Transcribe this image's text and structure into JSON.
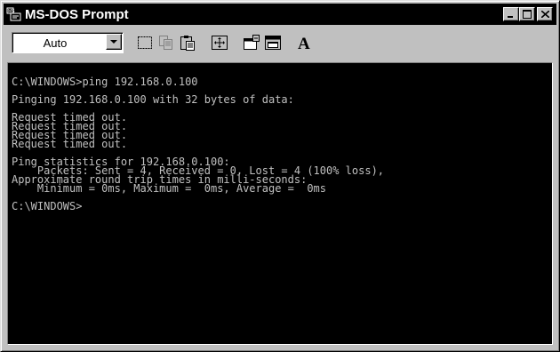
{
  "window": {
    "title": "MS-DOS Prompt",
    "icon": "msdos-icon",
    "controls": [
      "minimize-icon",
      "maximize-icon",
      "close-icon"
    ]
  },
  "toolbar": {
    "font_size_value": "Auto",
    "tools": [
      "mark-icon",
      "copy-icon",
      "paste-icon",
      "fullscreen-icon",
      "properties-icon",
      "background-icon",
      "font-icon"
    ],
    "font_button_glyph": "A"
  },
  "console": {
    "text_color": "#c0c0c0",
    "background_color": "#000000",
    "lines": [
      "C:\\WINDOWS>ping 192.168.0.100",
      "",
      "Pinging 192.168.0.100 with 32 bytes of data:",
      "",
      "Request timed out.",
      "Request timed out.",
      "Request timed out.",
      "Request timed out.",
      "",
      "Ping statistics for 192.168.0.100:",
      "    Packets: Sent = 4, Received = 0, Lost = 4 (100% loss),",
      "Approximate round trip times in milli-seconds:",
      "    Minimum = 0ms, Maximum =  0ms, Average =  0ms",
      "",
      "C:\\WINDOWS>"
    ]
  }
}
